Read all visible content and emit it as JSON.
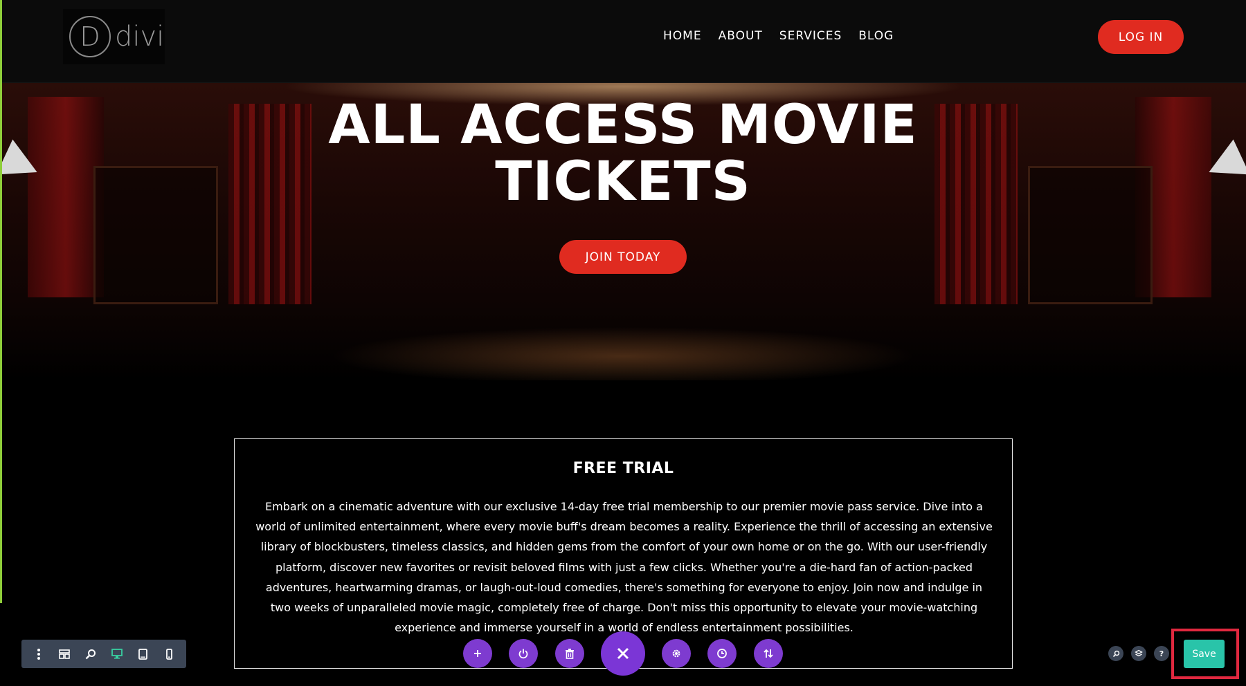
{
  "header": {
    "logo_letter": "D",
    "logo_text": "divi",
    "nav": [
      "HOME",
      "ABOUT",
      "SERVICES",
      "BLOG"
    ],
    "login_label": "LOG IN"
  },
  "hero": {
    "title_line1": "ALL ACCESS MOVIE",
    "title_line2": "TICKETS",
    "cta_label": "JOIN TODAY"
  },
  "trial": {
    "title": "FREE TRIAL",
    "body": "Embark on a cinematic adventure with our exclusive 14-day free trial membership to our premier movie pass service. Dive into a world of unlimited entertainment, where every movie buff's dream becomes a reality. Experience the thrill of accessing an extensive library of blockbusters, timeless classics, and hidden gems from the comfort of your own home or on the go. With our user-friendly platform, discover new favorites or revisit beloved films with just a few clicks. Whether you're a die-hard fan of action-packed adventures, heartwarming dramas, or laugh-out-loud comedies, there's something for everyone to enjoy. Join now and indulge in two weeks of unparalleled movie magic, completely free of charge. Don't miss this opportunity to elevate your movie-watching experience and immerse yourself in a world of endless entertainment possibilities."
  },
  "builder": {
    "left_toolbar_icons": [
      "more-icon",
      "wireframe-icon",
      "zoom-icon",
      "desktop-icon",
      "tablet-icon",
      "phone-icon"
    ],
    "center_buttons": [
      "add-icon",
      "power-icon",
      "trash-icon",
      "close-icon",
      "gear-icon",
      "history-icon",
      "portability-icon"
    ],
    "right_icons": [
      "search-icon",
      "layers-icon",
      "help-icon"
    ],
    "help_glyph": "?",
    "save_label": "Save"
  },
  "colors": {
    "accent_red": "#e02b20",
    "builder_purple": "#7e3bd0",
    "save_teal": "#29c4a9",
    "highlight_red": "#e0283f"
  }
}
